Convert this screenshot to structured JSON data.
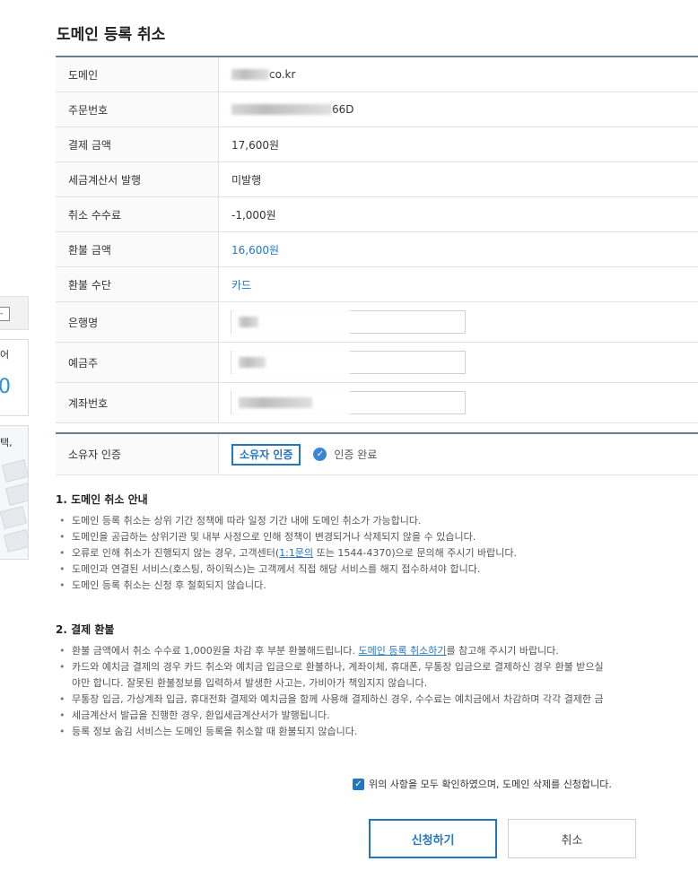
{
  "background": {
    "select_glyph": "-",
    "card_text": "어",
    "card_number": "0",
    "thumb_text": "택,"
  },
  "modal": {
    "title": "도메인 등록 취소"
  },
  "info": {
    "domain_label": "도메인",
    "domain_suffix": "co.kr",
    "order_label": "주문번호",
    "order_suffix": "66D",
    "payment_label": "결제 금액",
    "payment_value": "17,600원",
    "tax_label": "세금계산서 발행",
    "tax_value": "미발행",
    "fee_label": "취소 수수료",
    "fee_value": "-1,000원",
    "refund_label": "환불 금액",
    "refund_value": "16,600원",
    "method_label": "환불 수단",
    "method_value": "카드",
    "bank_label": "은행명",
    "holder_label": "예금주",
    "account_label": "계좌번호"
  },
  "owner": {
    "label": "소유자 인증",
    "button": "소유자 인증",
    "status": "인증 완료",
    "status_icon": "check-circle-icon"
  },
  "guide": {
    "title": "1. 도메인 취소 안내",
    "items": [
      "도메인 등록 취소는 상위 기간 정책에 따라 일정 기간 내에 도메인 취소가 가능합니다.",
      "도메인을 공급하는 상위기관 및 내부 사정으로 인해 정책이 변경되거나 삭제되지 않을 수 있습니다.",
      "도메인과 연결된 서비스(호스팅, 하이웍스)는 고객께서 직접 해당 서비스를 해지 접수하셔야 합니다.",
      "도메인 등록 취소는 신청 후 철회되지 않습니다."
    ],
    "error_pre": "오류로 인해 취소가 진행되지 않는 경우, 고객센터(",
    "error_link": "1:1문의",
    "error_post": " 또는 1544-4370)으로 문의해 주시기 바랍니다."
  },
  "refund": {
    "title": "2. 결제 환불",
    "item1_pre": "환불 금액에서 취소 수수료 1,000원을 차감 후 부분 환불해드립니다. ",
    "item1_link": "도메인 등록 취소하기",
    "item1_post": "를 참고해 주시기 바랍니다.",
    "item2": "카드와 예치금 결제의 경우 카드 취소와 예치금 입금으로 환불하나, 계좌이체, 휴대폰, 무통장 입금으로 결제하신 경우 환불 받으실",
    "item2_cont": "야만 합니다. 잘못된 환불정보를 입력하셔 발생한 사고는, 가비아가 책임지지 않습니다.",
    "item3": "무통장 입금, 가상계좌 입금, 휴대전화 결제와 예치금을 함께 사용해 결제하신 경우, 수수료는 예치금에서 차감하며 각각 결제한 금",
    "item4": "세금계산서 발급을 진행한 경우, 환입세금계산서가 발행됩니다.",
    "item5": "등록 정보 숨김 서비스는 도메인 등록을 취소할 때 환불되지 않습니다."
  },
  "agree": {
    "checked": true,
    "text": "위의 사항을 모두 확인하였으며, 도메인 삭제를 신청합니다."
  },
  "buttons": {
    "apply": "신청하기",
    "cancel": "취소"
  },
  "colors": {
    "accent": "#2377bf",
    "header_line": "#6b7c93",
    "check": "#3a86d6"
  }
}
